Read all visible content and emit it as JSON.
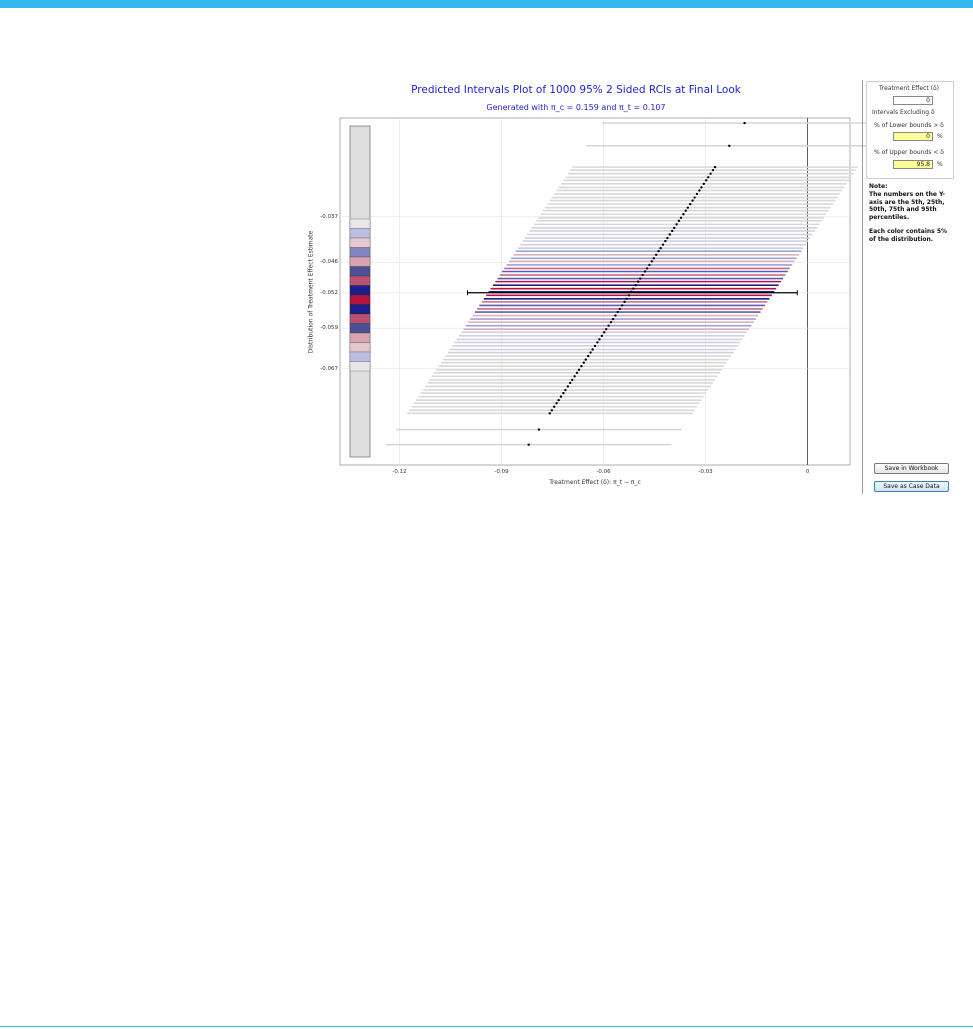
{
  "title": "Predicted Intervals Plot of 1000 95% 2 Sided RCIs at Final Look",
  "subtitle": "Generated with π_c = 0.159 and π_t = 0.107",
  "chart_data": {
    "type": "interval",
    "xlabel": "Treatment Effect (δ): π_t − π_c",
    "ylabel": "Distribution of Treatment Effect Estimate",
    "x_ticks": [
      "-0.12",
      "-0.09",
      "-0.06",
      "-0.03",
      "0"
    ],
    "x_tick_values": [
      -0.12,
      -0.09,
      -0.06,
      -0.03,
      0
    ],
    "xlim": [
      -0.1375,
      0.0125
    ],
    "y_ticks": [
      "-0.037",
      "-0.046",
      "-0.052",
      "-0.059",
      "-0.067"
    ],
    "y_tick_values": [
      -0.037,
      -0.046,
      -0.052,
      -0.059,
      -0.067
    ],
    "ylim": [
      -0.086,
      -0.0175
    ],
    "grid": true,
    "interval_half_width": 0.042,
    "point_estimates": [
      -0.0185,
      -0.023,
      -0.0272,
      -0.0278,
      -0.0285,
      -0.0292,
      -0.0298,
      -0.0305,
      -0.0312,
      -0.0318,
      -0.0325,
      -0.0332,
      -0.0338,
      -0.0345,
      -0.0352,
      -0.0358,
      -0.0365,
      -0.0372,
      -0.0378,
      -0.0385,
      -0.0392,
      -0.0398,
      -0.0405,
      -0.0412,
      -0.0418,
      -0.0425,
      -0.0432,
      -0.0438,
      -0.0445,
      -0.0452,
      -0.0458,
      -0.0465,
      -0.0472,
      -0.0478,
      -0.0485,
      -0.0492,
      -0.0498,
      -0.0505,
      -0.0512,
      -0.0518,
      -0.0525,
      -0.0532,
      -0.0538,
      -0.0545,
      -0.0552,
      -0.0558,
      -0.0565,
      -0.0572,
      -0.0578,
      -0.0585,
      -0.0592,
      -0.0598,
      -0.0605,
      -0.0612,
      -0.0618,
      -0.0625,
      -0.0632,
      -0.0638,
      -0.0645,
      -0.0652,
      -0.0658,
      -0.0665,
      -0.0672,
      -0.0678,
      -0.0685,
      -0.0692,
      -0.0698,
      -0.0705,
      -0.0712,
      -0.0718,
      -0.0725,
      -0.0732,
      -0.0738,
      -0.0745,
      -0.0752,
      -0.0758,
      -0.079,
      -0.082
    ],
    "highlighted_interval": {
      "estimate": -0.052,
      "lower": -0.1,
      "upper": -0.003
    },
    "distribution_colors": [
      "#e9e5ea",
      "#bdbfe0",
      "#e5c8cf",
      "#8287c4",
      "#d9a3b2",
      "#4d4f97",
      "#b85170",
      "#1c1f88",
      "#b3143d",
      "#1c1f88",
      "#b85170",
      "#4d4f97",
      "#d9a3b2",
      "#e5c8cf",
      "#bdbfe0",
      "#e9e5ea"
    ]
  },
  "panel": {
    "treatment_effect_label": "Treatment Effect (δ)",
    "treatment_effect_value": "0",
    "intervals_excluding_label": "Intervals Excluding δ",
    "lower_bounds_label": "% of Lower bounds > δ",
    "lower_bounds_value": "0",
    "upper_bounds_label": "% of Upper bounds < δ",
    "upper_bounds_value": "95.8",
    "percent_sign": "%"
  },
  "note": {
    "heading": "Note:",
    "line1": "The numbers on the Y-axis are the 5th, 25th, 50th, 75th and 95th percentiles.",
    "line2": "Each color contains 5% of the distribution."
  },
  "buttons": {
    "save_workbook": "Save in Workbook",
    "save_case_data": "Save as Case Data"
  }
}
